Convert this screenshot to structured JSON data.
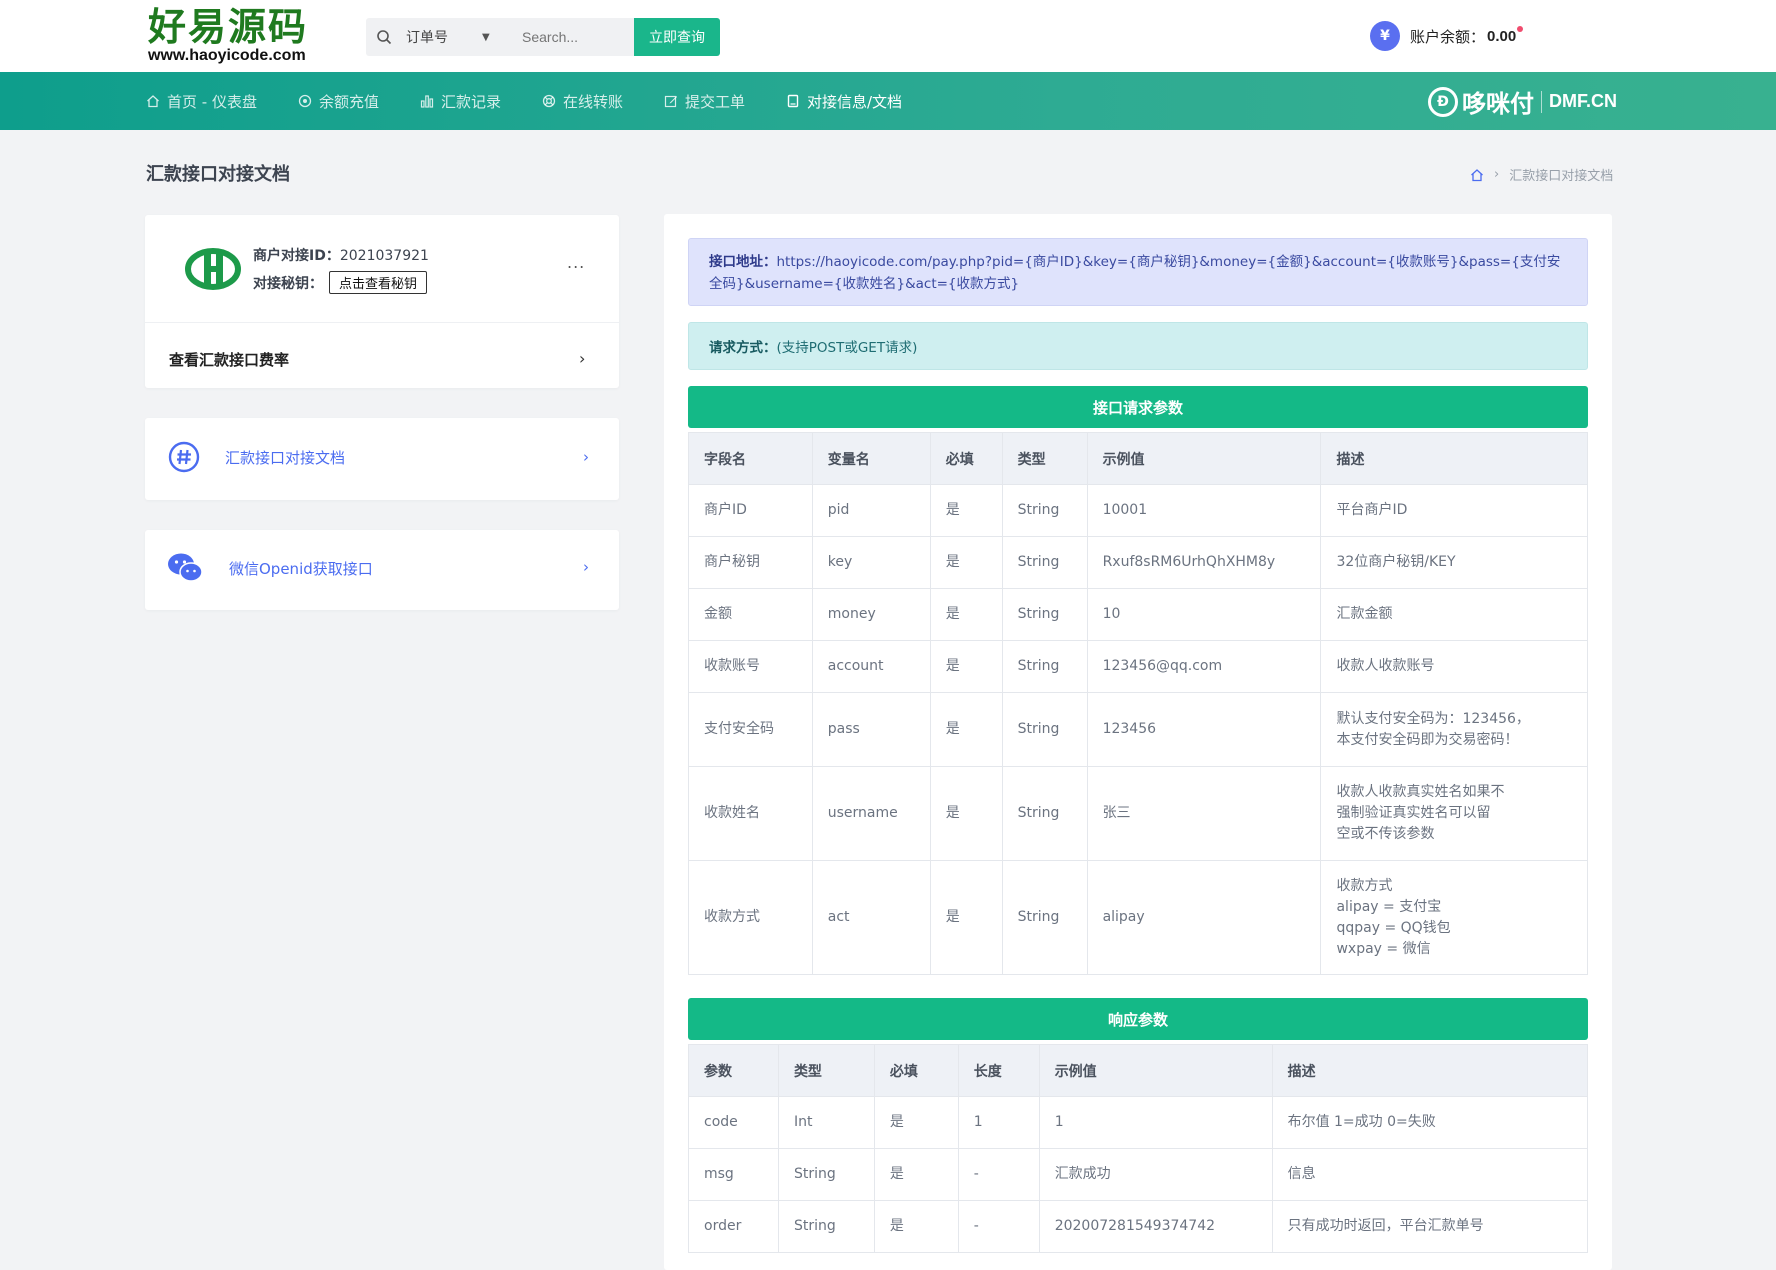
{
  "logo": {
    "main": "好易源码",
    "sub": "www.haoyicode.com"
  },
  "search": {
    "select": "订单号",
    "placeholder": "Search...",
    "button": "立即查询"
  },
  "balance": {
    "label": "账户余额：",
    "value": "0.00"
  },
  "nav": [
    {
      "label": "首页 - 仪表盘",
      "icon": "home-icon"
    },
    {
      "label": "余额充值",
      "icon": "target-icon"
    },
    {
      "label": "汇款记录",
      "icon": "bar-chart-icon"
    },
    {
      "label": "在线转账",
      "icon": "life-ring-icon"
    },
    {
      "label": "提交工单",
      "icon": "edit-icon"
    },
    {
      "label": "对接信息/文档",
      "icon": "document-icon"
    }
  ],
  "brand": {
    "cn": "哆咪付",
    "en": "DMF.CN"
  },
  "page": {
    "title": "汇款接口对接文档",
    "breadcrumb": "汇款接口对接文档"
  },
  "merchant": {
    "id_label": "商户对接ID：",
    "id_value": "2021037921",
    "secret_label": "对接秘钥：",
    "secret_button": "点击查看秘钥",
    "more": "...",
    "rate_link": "查看汇款接口费率"
  },
  "links": {
    "doc": "汇款接口对接文档",
    "wechat": "微信Openid获取接口"
  },
  "api": {
    "url_label": "接口地址：",
    "url": "https://haoyicode.com/pay.php?pid={商户ID}&key={商户秘钥}&money={金额}&account={收款账号}&pass={支付安全码}&username={收款姓名}&act={收款方式}",
    "method_label": "请求方式：",
    "method": "(支持POST或GET请求)"
  },
  "request": {
    "title": "接口请求参数",
    "headers": [
      "字段名",
      "变量名",
      "必填",
      "类型",
      "示例值",
      "描述"
    ],
    "rows": [
      [
        "商户ID",
        "pid",
        "是",
        "String",
        "10001",
        "平台商户ID"
      ],
      [
        "商户秘钥",
        "key",
        "是",
        "String",
        "Rxuf8sRM6UrhQhXHM8y",
        "32位商户秘钥/KEY"
      ],
      [
        "金额",
        "money",
        "是",
        "String",
        "10",
        "汇款金额"
      ],
      [
        "收款账号",
        "account",
        "是",
        "String",
        "123456@qq.com",
        "收款人收款账号"
      ],
      [
        "支付安全码",
        "pass",
        "是",
        "String",
        "123456",
        "默认支付安全码为：123456，\n本支付安全码即为交易密码！"
      ],
      [
        "收款姓名",
        "username",
        "是",
        "String",
        "张三",
        "收款人收款真实姓名如果不\n强制验证真实姓名可以留\n空或不传该参数"
      ],
      [
        "收款方式",
        "act",
        "是",
        "String",
        "alipay",
        "收款方式\nalipay = 支付宝\nqqpay = QQ钱包\nwxpay = 微信"
      ]
    ]
  },
  "response": {
    "title": "响应参数",
    "headers": [
      "参数",
      "类型",
      "必填",
      "长度",
      "示例值",
      "描述"
    ],
    "rows": [
      [
        "code",
        "Int",
        "是",
        "1",
        "1",
        "布尔值 1=成功 0=失败"
      ],
      [
        "msg",
        "String",
        "是",
        "-",
        "汇款成功",
        "信息"
      ],
      [
        "order",
        "String",
        "是",
        "-",
        "202007281549374742",
        "只有成功时返回，平台汇款单号"
      ]
    ]
  },
  "colors": {
    "accent": "#14b987",
    "nav": "#0e9e8c",
    "link": "#4b6cf0"
  }
}
